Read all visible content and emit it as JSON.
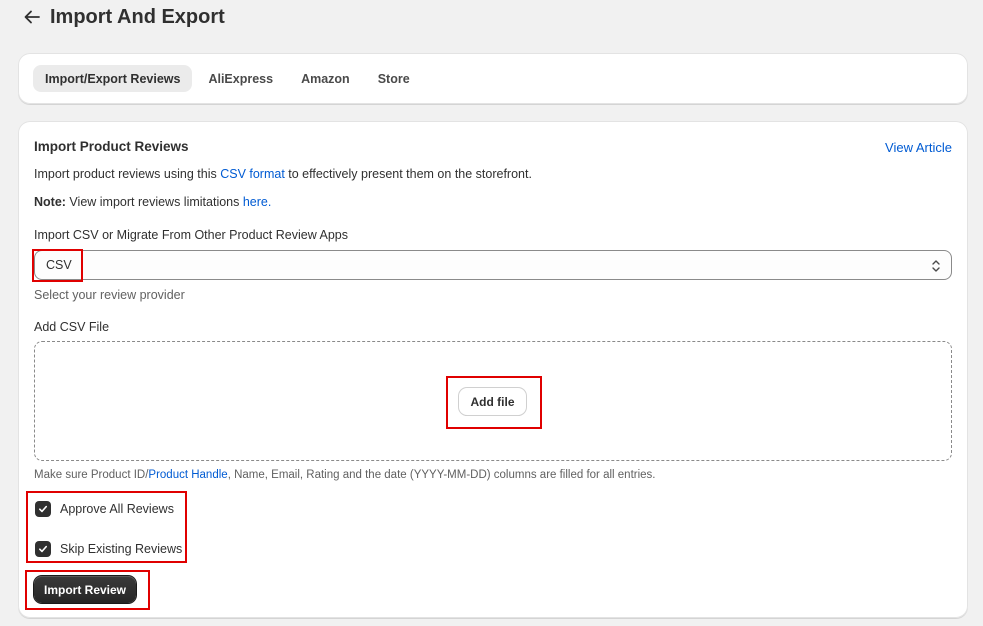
{
  "header": {
    "title": "Import And Export",
    "back_icon": "arrow-left-icon"
  },
  "tabs": [
    {
      "label": "Import/Export Reviews",
      "active": true
    },
    {
      "label": "AliExpress",
      "active": false
    },
    {
      "label": "Amazon",
      "active": false
    },
    {
      "label": "Store",
      "active": false
    }
  ],
  "section": {
    "title": "Import Product Reviews",
    "view_article": "View Article",
    "desc_prefix": "Import product reviews using this ",
    "desc_link": "CSV format",
    "desc_suffix": " to effectively present them on the storefront.",
    "note_label": "Note:",
    "note_text": " View import reviews limitations ",
    "note_link": "here."
  },
  "provider": {
    "label": "Import CSV or Migrate From Other Product Review Apps",
    "selected": "CSV",
    "help": "Select your review provider"
  },
  "file": {
    "label": "Add CSV File",
    "button": "Add file",
    "help_prefix": "Make sure Product ID/",
    "help_link": "Product Handle",
    "help_suffix": ", Name, Email, Rating and the date (YYYY-MM-DD) columns are filled for all entries."
  },
  "options": [
    {
      "label": "Approve All Reviews",
      "checked": true
    },
    {
      "label": "Skip Existing Reviews",
      "checked": true
    }
  ],
  "actions": {
    "import": "Import Review"
  },
  "colors": {
    "background": "#f1f1f1",
    "link": "#005bd3",
    "highlight": "#e00000",
    "primary_button": "#303030"
  }
}
